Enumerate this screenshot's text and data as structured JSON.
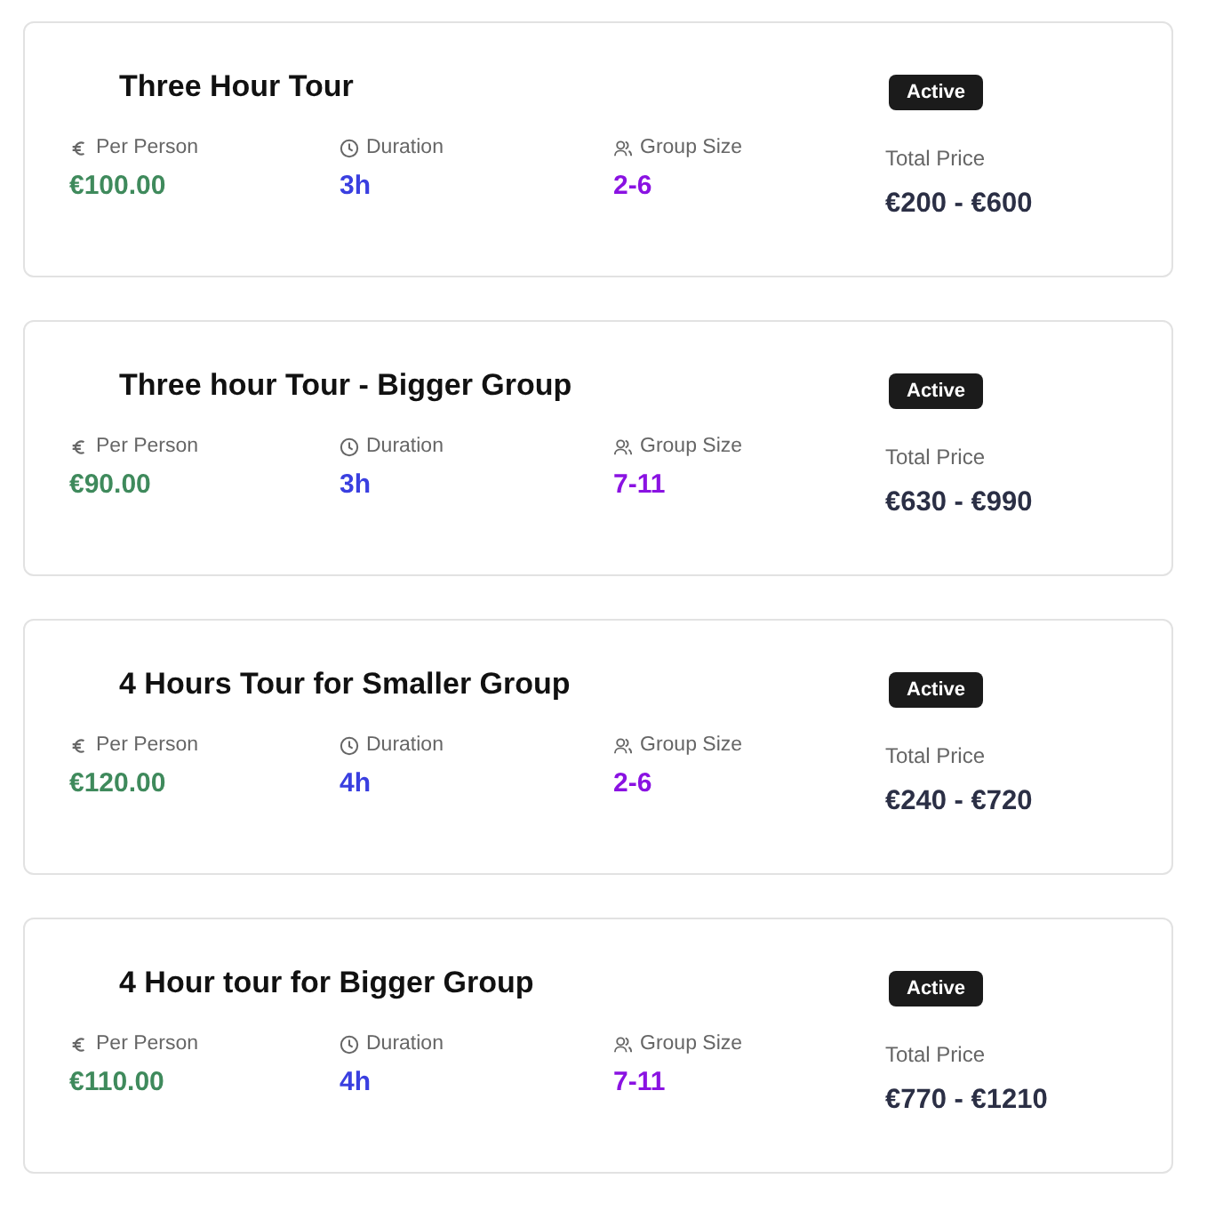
{
  "tours": [
    {
      "title": "Three Hour Tour",
      "status": "Active",
      "per_person_label": "Per Person",
      "per_person": "€100.00",
      "duration_label": "Duration",
      "duration": "3h",
      "group_label": "Group Size",
      "group": "2-6",
      "total_label": "Total Price",
      "total": "€200 - €600"
    },
    {
      "title": "Three hour Tour - Bigger Group",
      "status": "Active",
      "per_person_label": "Per Person",
      "per_person": "€90.00",
      "duration_label": "Duration",
      "duration": "3h",
      "group_label": "Group Size",
      "group": "7-11",
      "total_label": "Total Price",
      "total": "€630 - €990"
    },
    {
      "title": "4 Hours Tour for Smaller Group",
      "status": "Active",
      "per_person_label": "Per Person",
      "per_person": "€120.00",
      "duration_label": "Duration",
      "duration": "4h",
      "group_label": "Group Size",
      "group": "2-6",
      "total_label": "Total Price",
      "total": "€240 - €720"
    },
    {
      "title": "4 Hour tour for Bigger Group",
      "status": "Active",
      "per_person_label": "Per Person",
      "per_person": "€110.00",
      "duration_label": "Duration",
      "duration": "4h",
      "group_label": "Group Size",
      "group": "7-11",
      "total_label": "Total Price",
      "total": "€770 - €1210"
    }
  ]
}
